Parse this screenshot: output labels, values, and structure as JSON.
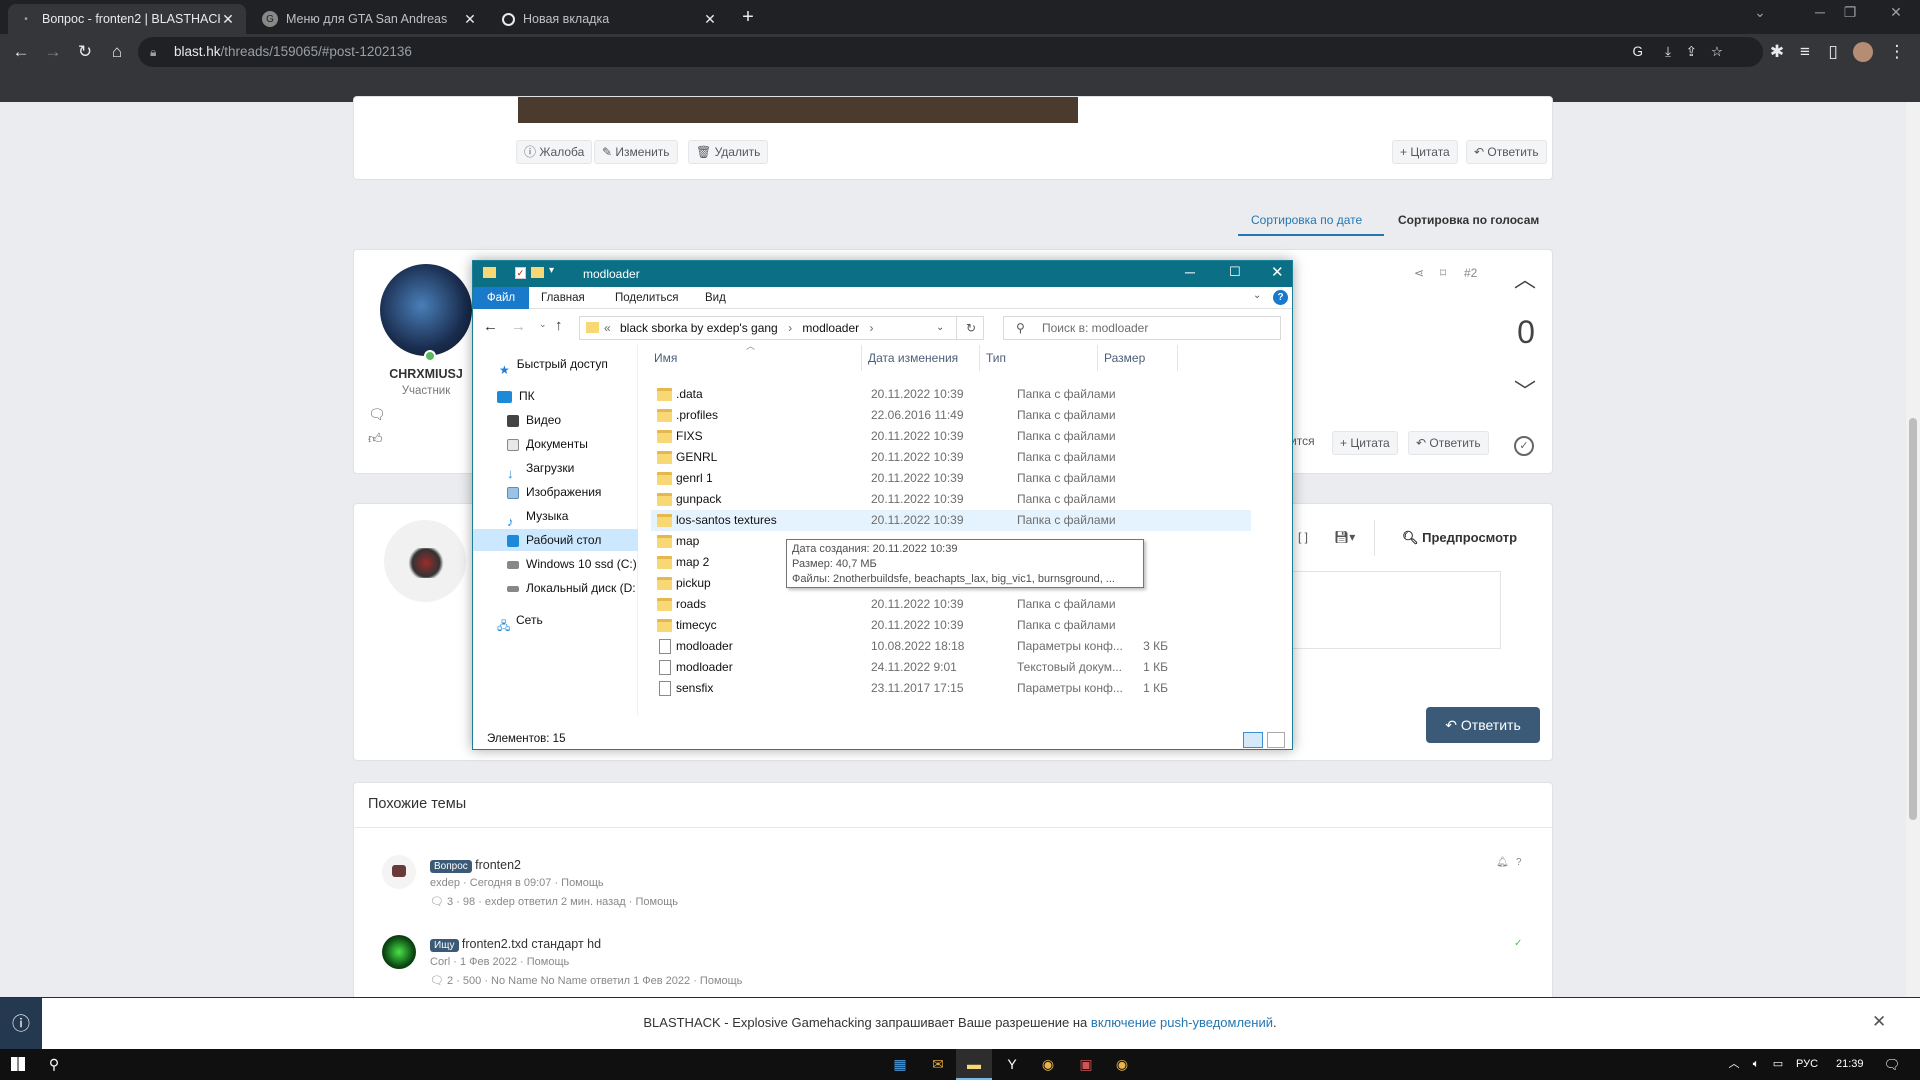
{
  "browser": {
    "tabs": [
      {
        "title": "Вопрос - fronten2 | BLASTHACK",
        "active": true
      },
      {
        "title": "Меню для GTA San Andreas",
        "active": false
      },
      {
        "title": "Новая вкладка",
        "active": false
      }
    ],
    "url_host": "blast.hk",
    "url_path": "/threads/159065/#post-1202136"
  },
  "post1": {
    "buttons": {
      "report": "Жалоба",
      "edit": "Изменить",
      "delete": "Удалить",
      "quote": "+ Цитата",
      "reply": "Ответить"
    }
  },
  "sort": {
    "by_date": "Сортировка по дате",
    "by_votes": "Сортировка по голосам"
  },
  "post2": {
    "username": "CHRXMIUSJ",
    "role": "Участник",
    "post_number": "#2",
    "vote_count": "0",
    "quote": "+ Цитата",
    "reply": "Ответить",
    "share_partial": "ится"
  },
  "editor": {
    "preview": "Предпросмотр",
    "submit": "Ответить"
  },
  "similar": {
    "title": "Похожие темы",
    "items": [
      {
        "badge": "Вопрос",
        "title": "fronten2",
        "meta": "exdep · Сегодня в 09:07 · Помощь",
        "stats": "3 · 98 · exdep ответил 2 мин. назад · Помощь"
      },
      {
        "badge": "Ищу",
        "title": "fronten2.txd стандарт hd",
        "meta": "Corl · 1 Фев 2022 · Помощь",
        "stats": "2 · 500 · No Name No Name ответил 1 Фев 2022 · Помощь"
      }
    ]
  },
  "explorer": {
    "title": "modloader",
    "ribbon": [
      "Файл",
      "Главная",
      "Поделиться",
      "Вид"
    ],
    "address": [
      "black sborka by exdep's gang",
      "modloader"
    ],
    "search_placeholder": "Поиск в: modloader",
    "sidebar": [
      "Быстрый доступ",
      "ПК",
      "Видео",
      "Документы",
      "Загрузки",
      "Изображения",
      "Музыка",
      "Рабочий стол",
      "Windows 10 ssd (C:)",
      "Локальный диск (D:",
      "Сеть"
    ],
    "columns": [
      "Имя",
      "Дата изменения",
      "Тип",
      "Размер"
    ],
    "files": [
      {
        "name": ".data",
        "date": "20.11.2022 10:39",
        "type": "Папка с файлами",
        "size": "",
        "kind": "folder"
      },
      {
        "name": ".profiles",
        "date": "22.06.2016 11:49",
        "type": "Папка с файлами",
        "size": "",
        "kind": "folder"
      },
      {
        "name": "FIXS",
        "date": "20.11.2022 10:39",
        "type": "Папка с файлами",
        "size": "",
        "kind": "folder"
      },
      {
        "name": "GENRL",
        "date": "20.11.2022 10:39",
        "type": "Папка с файлами",
        "size": "",
        "kind": "folder"
      },
      {
        "name": "genrl 1",
        "date": "20.11.2022 10:39",
        "type": "Папка с файлами",
        "size": "",
        "kind": "folder"
      },
      {
        "name": "gunpack",
        "date": "20.11.2022 10:39",
        "type": "Папка с файлами",
        "size": "",
        "kind": "folder"
      },
      {
        "name": "los-santos textures",
        "date": "20.11.2022 10:39",
        "type": "Папка с файлами",
        "size": "",
        "kind": "folder",
        "hover": true
      },
      {
        "name": "map",
        "date": "",
        "type": "",
        "size": "",
        "kind": "folder"
      },
      {
        "name": "map 2",
        "date": "",
        "type": "",
        "size": "",
        "kind": "folder"
      },
      {
        "name": "pickup",
        "date": "",
        "type": "",
        "size": "",
        "kind": "folder"
      },
      {
        "name": "roads",
        "date": "20.11.2022 10:39",
        "type": "Папка с файлами",
        "size": "",
        "kind": "folder"
      },
      {
        "name": "timecyc",
        "date": "20.11.2022 10:39",
        "type": "Папка с файлами",
        "size": "",
        "kind": "folder"
      },
      {
        "name": "modloader",
        "date": "10.08.2022 18:18",
        "type": "Параметры конф...",
        "size": "3 КБ",
        "kind": "doc"
      },
      {
        "name": "modloader",
        "date": "24.11.2022 9:01",
        "type": "Текстовый докум...",
        "size": "1 КБ",
        "kind": "doc"
      },
      {
        "name": "sensfix",
        "date": "23.11.2017 17:15",
        "type": "Параметры конф...",
        "size": "1 КБ",
        "kind": "doc"
      }
    ],
    "tooltip": {
      "created": "Дата создания: 20.11.2022 10:39",
      "size": "Размер: 40,7 МБ",
      "files": "Файлы: 2notherbuildsfe, beachapts_lax, big_vic1, burnsground, ..."
    },
    "status": "Элементов: 15"
  },
  "notification": {
    "text_before": "BLASTHACK - Explosive Gamehacking запрашивает Ваше разрешение на ",
    "link": "включение push-уведомлений",
    "text_after": "."
  },
  "taskbar": {
    "lang": "РУС",
    "time": "21:39"
  },
  "colors": {
    "explorer_title": "#0b6f86",
    "ribbon_file": "#1979ca",
    "reply_button": "#3a5a78",
    "link": "#2577b1"
  }
}
